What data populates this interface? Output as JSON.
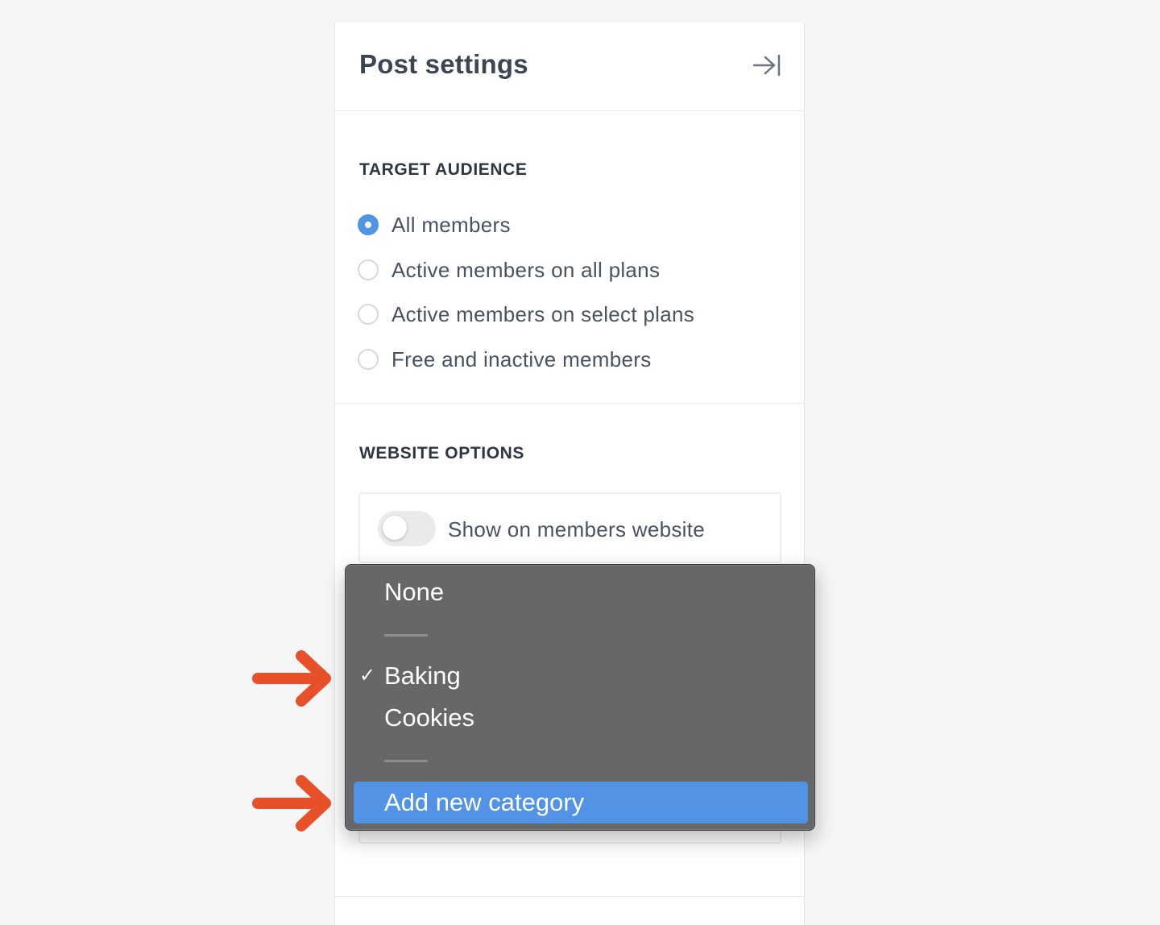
{
  "panel": {
    "title": "Post settings",
    "collapse_icon": "collapse-right-icon"
  },
  "audience": {
    "heading": "TARGET AUDIENCE",
    "options": [
      {
        "label": "All members",
        "checked": true
      },
      {
        "label": "Active members on all plans",
        "checked": false
      },
      {
        "label": "Active members on select plans",
        "checked": false
      },
      {
        "label": "Free and inactive members",
        "checked": false
      }
    ]
  },
  "website": {
    "heading": "WEBSITE OPTIONS",
    "toggle_label": "Show on members website",
    "toggle_on": false
  },
  "dropdown": {
    "items": [
      {
        "label": "None"
      },
      {
        "label": "Baking",
        "selected": true
      },
      {
        "label": "Cookies"
      },
      {
        "label": "Add new category",
        "highlighted": true
      }
    ],
    "check_mark": "✓"
  },
  "colors": {
    "accent": "#4f95e3",
    "highlight": "#5293e6",
    "annotation_arrow": "#e8502a"
  }
}
